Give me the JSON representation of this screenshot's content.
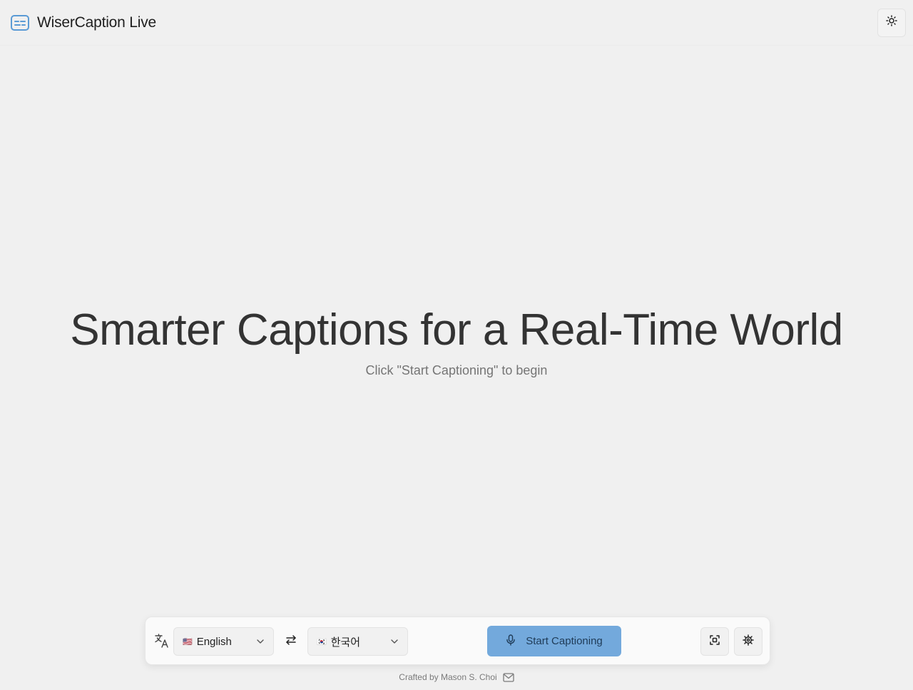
{
  "header": {
    "title": "WiserCaption Live",
    "logo_icon": "captions-icon",
    "theme_toggle_icon": "sun-icon"
  },
  "hero": {
    "title": "Smarter Captions for a Real-Time World",
    "subtitle": "Click \"Start Captioning\" to begin"
  },
  "controls": {
    "translate_icon": "translate-icon",
    "source_language": {
      "flag": "🇺🇸",
      "label": "English"
    },
    "swap_icon": "swap-arrows-icon",
    "target_language": {
      "flag": "🇰🇷",
      "label": "한국어"
    },
    "start_button": {
      "label": "Start Captioning",
      "icon": "microphone-icon"
    },
    "fullscreen_icon": "fullscreen-icon",
    "settings_icon": "gear-icon"
  },
  "footer": {
    "credit": "Crafted by Mason S. Choi",
    "mail_icon": "mail-icon"
  },
  "colors": {
    "background": "#f0f0f0",
    "accent": "#73a9dc",
    "logo": "#5b9bd5"
  }
}
